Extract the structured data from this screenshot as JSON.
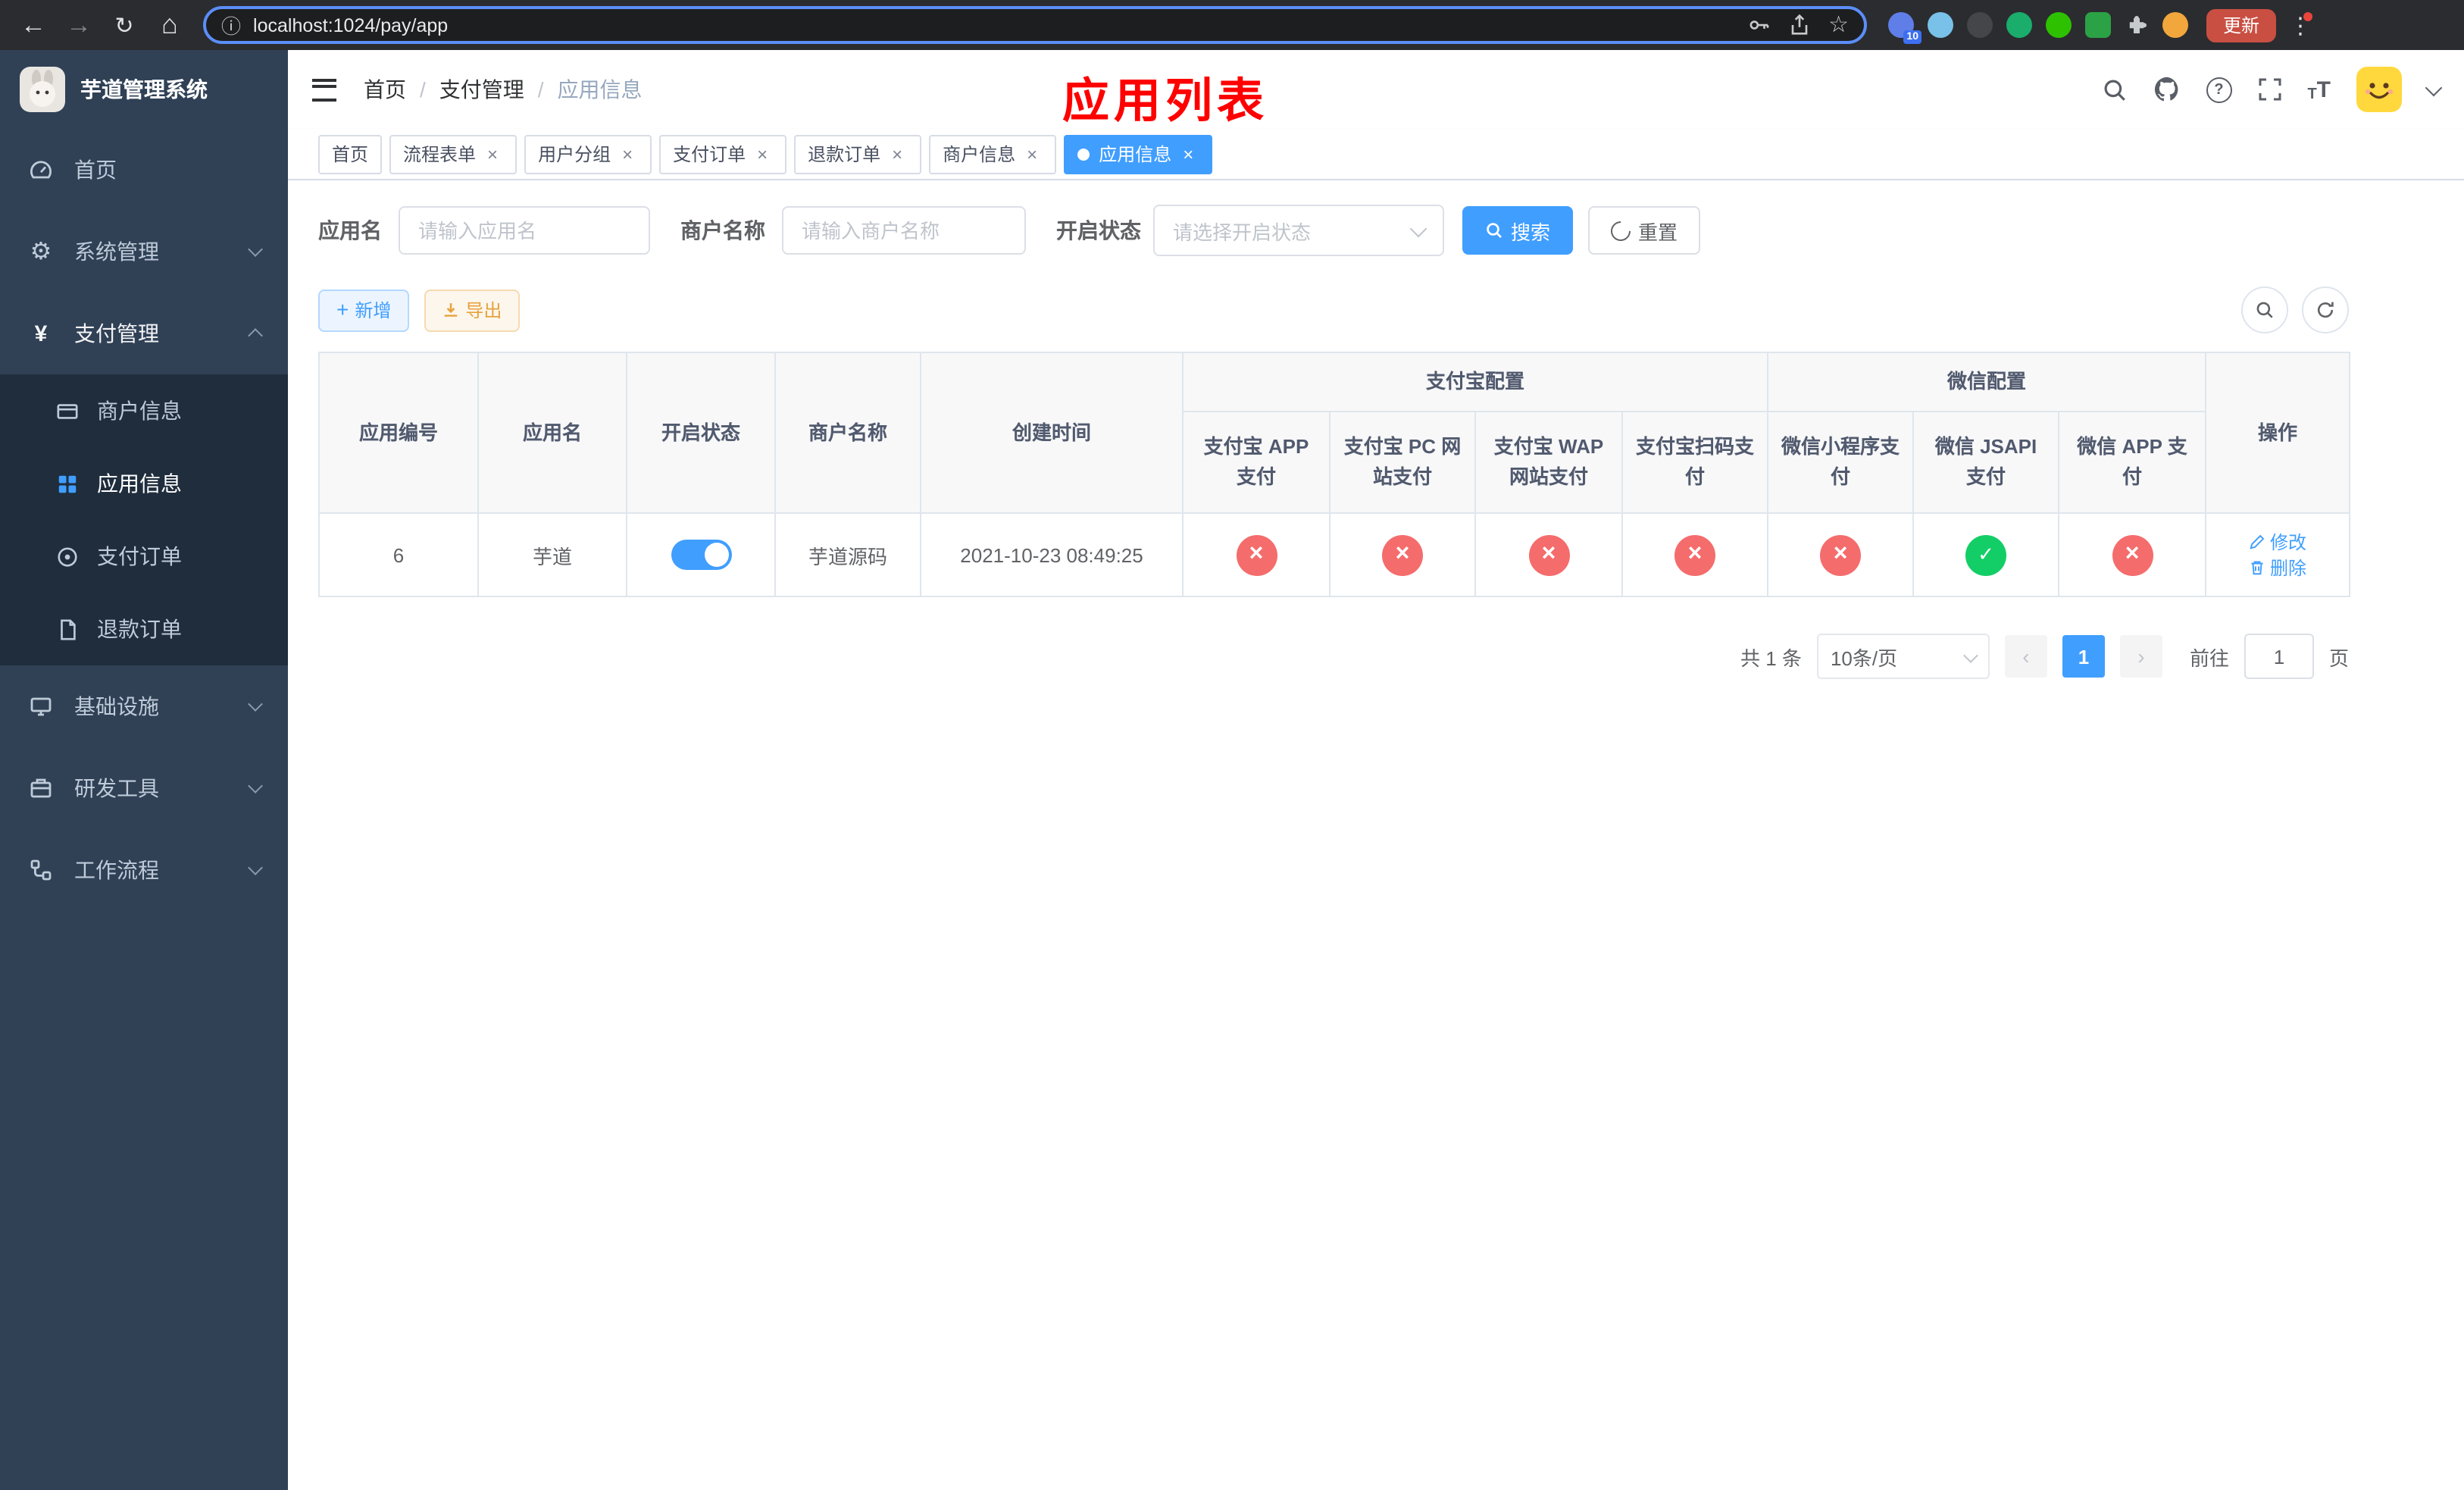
{
  "colors": {
    "accent": "#409eff",
    "success": "#13ce66",
    "danger": "#f56c6c",
    "warning": "#e6a23c",
    "sidebar_bg": "#304156",
    "annotation_red": "#ff0000"
  },
  "browser": {
    "url": "localhost:1024/pay/app",
    "update_label": "更新",
    "extension_badge": "10"
  },
  "sidebar": {
    "title": "芋道管理系统",
    "items": [
      {
        "label": "首页"
      },
      {
        "label": "系统管理"
      },
      {
        "label": "支付管理",
        "children": [
          {
            "label": "商户信息"
          },
          {
            "label": "应用信息"
          },
          {
            "label": "支付订单"
          },
          {
            "label": "退款订单"
          }
        ]
      },
      {
        "label": "基础设施"
      },
      {
        "label": "研发工具"
      },
      {
        "label": "工作流程"
      }
    ]
  },
  "header": {
    "breadcrumb": [
      "首页",
      "支付管理",
      "应用信息"
    ],
    "annotation": "应用列表"
  },
  "tabs": [
    {
      "label": "首页"
    },
    {
      "label": "流程表单"
    },
    {
      "label": "用户分组"
    },
    {
      "label": "支付订单"
    },
    {
      "label": "退款订单"
    },
    {
      "label": "商户信息"
    },
    {
      "label": "应用信息"
    }
  ],
  "filters": {
    "app_name_label": "应用名",
    "app_name_placeholder": "请输入应用名",
    "merchant_label": "商户名称",
    "merchant_placeholder": "请输入商户名称",
    "status_label": "开启状态",
    "status_placeholder": "请选择开启状态",
    "search_label": "搜索",
    "reset_label": "重置"
  },
  "toolbar": {
    "add_label": "新增",
    "export_label": "导出"
  },
  "table": {
    "columns": [
      "应用编号",
      "应用名",
      "开启状态",
      "商户名称",
      "创建时间"
    ],
    "groups": [
      {
        "label": "支付宝配置",
        "children": [
          "支付宝 APP 支付",
          "支付宝 PC 网站支付",
          "支付宝 WAP 网站支付",
          "支付宝扫码支付"
        ]
      },
      {
        "label": "微信配置",
        "children": [
          "微信小程序支付",
          "微信 JSAPI 支付",
          "微信 APP 支付"
        ]
      }
    ],
    "actions_label": "操作",
    "rows": [
      {
        "id": "6",
        "name": "芋道",
        "enabled": true,
        "merchant": "芋道源码",
        "created": "2021-10-23 08:49:25",
        "configs": [
          false,
          false,
          false,
          false,
          false,
          true,
          false
        ],
        "edit_label": "修改",
        "delete_label": "删除"
      }
    ]
  },
  "pagination": {
    "total": "共 1 条",
    "page_size": "10条/页",
    "page": "1",
    "goto_label": "前往",
    "goto_value": "1",
    "unit_label": "页"
  }
}
